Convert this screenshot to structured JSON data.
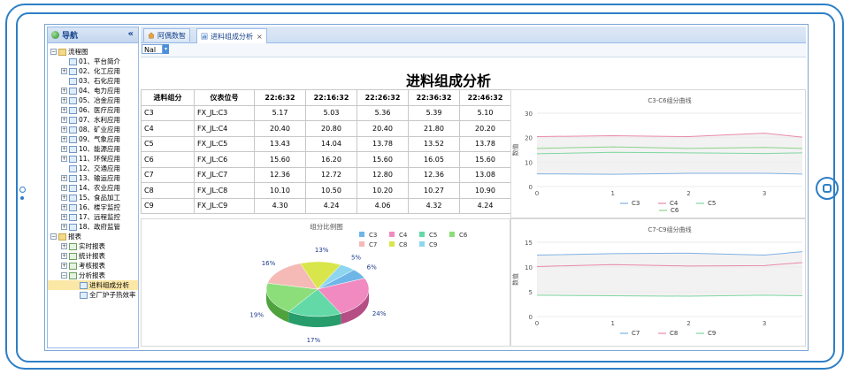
{
  "nav": {
    "title": "导航",
    "collapse_glyph": "«",
    "tree": [
      {
        "label": "流程图",
        "level": 0,
        "toggle": "⊟",
        "icon": "folder"
      },
      {
        "label": "01、平台简介",
        "level": 1,
        "toggle": "",
        "icon": "chart"
      },
      {
        "label": "02、化工应用",
        "level": 1,
        "toggle": "⊞",
        "icon": "chart"
      },
      {
        "label": "03、石化应用",
        "level": 1,
        "toggle": "",
        "icon": "chart"
      },
      {
        "label": "04、电力应用",
        "level": 1,
        "toggle": "⊞",
        "icon": "chart"
      },
      {
        "label": "05、冶金应用",
        "level": 1,
        "toggle": "⊞",
        "icon": "chart"
      },
      {
        "label": "06、医疗应用",
        "level": 1,
        "toggle": "⊞",
        "icon": "chart"
      },
      {
        "label": "07、水利应用",
        "level": 1,
        "toggle": "⊞",
        "icon": "chart"
      },
      {
        "label": "08、矿业应用",
        "level": 1,
        "toggle": "⊞",
        "icon": "chart"
      },
      {
        "label": "09、气象应用",
        "level": 1,
        "toggle": "⊞",
        "icon": "chart"
      },
      {
        "label": "10、能源应用",
        "level": 1,
        "toggle": "⊞",
        "icon": "chart"
      },
      {
        "label": "11、环保应用",
        "level": 1,
        "toggle": "⊞",
        "icon": "chart"
      },
      {
        "label": "12、交通应用",
        "level": 1,
        "toggle": "",
        "icon": "chart"
      },
      {
        "label": "13、输运应用",
        "level": 1,
        "toggle": "⊞",
        "icon": "chart"
      },
      {
        "label": "14、农业应用",
        "level": 1,
        "toggle": "⊞",
        "icon": "chart"
      },
      {
        "label": "15、食品加工",
        "level": 1,
        "toggle": "⊞",
        "icon": "chart"
      },
      {
        "label": "16、楼宇监控",
        "level": 1,
        "toggle": "⊞",
        "icon": "chart"
      },
      {
        "label": "17、远程监控",
        "level": 1,
        "toggle": "⊞",
        "icon": "chart"
      },
      {
        "label": "18、政府监管",
        "level": 1,
        "toggle": "⊞",
        "icon": "chart"
      },
      {
        "label": "报表",
        "level": 0,
        "toggle": "⊟",
        "icon": "folder"
      },
      {
        "label": "实时报表",
        "level": 1,
        "toggle": "⊞",
        "icon": "rpt"
      },
      {
        "label": "统计报表",
        "level": 1,
        "toggle": "⊞",
        "icon": "rpt"
      },
      {
        "label": "考核报表",
        "level": 1,
        "toggle": "⊞",
        "icon": "rpt"
      },
      {
        "label": "分析报表",
        "level": 1,
        "toggle": "⊟",
        "icon": "rpt"
      },
      {
        "label": "进料组成分析",
        "level": 2,
        "toggle": "",
        "icon": "chart",
        "selected": true
      },
      {
        "label": "全厂炉子热效率",
        "level": 2,
        "toggle": "",
        "icon": "chart"
      }
    ]
  },
  "tabs": [
    {
      "label": "阿偶数智",
      "icon": "home-icon",
      "closable": false,
      "active": false
    },
    {
      "label": "进料组成分析",
      "icon": "report-icon",
      "closable": true,
      "active": true
    }
  ],
  "toolbar": {
    "select_value": "Nal"
  },
  "report": {
    "title": "进料组成分析",
    "table": {
      "headers": [
        "进料组分",
        "仪表位号",
        "22:6:32",
        "22:16:32",
        "22:26:32",
        "22:36:32",
        "22:46:32"
      ],
      "rows": [
        [
          "C3",
          "FX_JL:C3",
          "5.17",
          "5.03",
          "5.36",
          "5.39",
          "5.10"
        ],
        [
          "C4",
          "FX_JL:C4",
          "20.40",
          "20.80",
          "20.40",
          "21.80",
          "20.20"
        ],
        [
          "C5",
          "FX_JL:C5",
          "13.43",
          "14.04",
          "13.78",
          "13.52",
          "13.78"
        ],
        [
          "C6",
          "FX_JL:C6",
          "15.60",
          "16.20",
          "15.60",
          "16.05",
          "15.60"
        ],
        [
          "C7",
          "FX_JL:C7",
          "12.36",
          "12.72",
          "12.80",
          "12.36",
          "13.08"
        ],
        [
          "C8",
          "FX_JL:C8",
          "10.10",
          "10.50",
          "10.20",
          "10.27",
          "10.90"
        ],
        [
          "C9",
          "FX_JL:C9",
          "4.30",
          "4.24",
          "4.06",
          "4.32",
          "4.24"
        ]
      ]
    }
  },
  "chart_data": [
    {
      "type": "line",
      "title": "C3-C6组分曲线",
      "ylabel": "数值",
      "xlabel": "",
      "x": [
        0,
        1,
        2,
        3,
        3.5
      ],
      "xticks": [
        0,
        1,
        2,
        3
      ],
      "ylim": [
        0,
        30
      ],
      "yticks": [
        0,
        10,
        20,
        30
      ],
      "series": [
        {
          "name": "C3",
          "color": "#7fb1e3",
          "values": [
            5.2,
            5.0,
            5.4,
            5.4,
            5.1
          ]
        },
        {
          "name": "C4",
          "color": "#e98aa8",
          "values": [
            20.4,
            20.8,
            20.4,
            21.8,
            20.2
          ]
        },
        {
          "name": "C5",
          "color": "#7fd7a1",
          "values": [
            13.4,
            14.0,
            13.8,
            13.5,
            13.8
          ]
        },
        {
          "name": "C6",
          "color": "#8ed18a",
          "values": [
            15.6,
            16.2,
            15.6,
            16.0,
            15.6
          ]
        }
      ],
      "legend_rows": [
        [
          "C3",
          "C4",
          "C5"
        ],
        [
          "C6"
        ]
      ],
      "legend": "bottom"
    },
    {
      "type": "pie",
      "title": "组分比例图",
      "labels": [
        "C3",
        "C4",
        "C5",
        "C6",
        "C7",
        "C8",
        "C9"
      ],
      "values": [
        6,
        24,
        17,
        19,
        16,
        13,
        5
      ],
      "value_labels": [
        "6%",
        "24%",
        "17%",
        "19%",
        "16%",
        "13%",
        "5%"
      ],
      "colors": [
        "#6fb6e8",
        "#f08ac0",
        "#62d9a7",
        "#8bde7a",
        "#f5b9b6",
        "#d9e64b",
        "#8ed6ef"
      ],
      "legend_rows": [
        [
          "C3",
          "C4",
          "C5",
          "C6"
        ],
        [
          "C7",
          "C8",
          "C9"
        ]
      ],
      "legend": "top-right"
    },
    {
      "type": "line",
      "title": "C7-C9组分曲线",
      "ylabel": "数值",
      "xlabel": "",
      "x": [
        0,
        1,
        2,
        3,
        3.5
      ],
      "xticks": [
        0,
        1,
        2,
        3
      ],
      "ylim": [
        0,
        15
      ],
      "yticks": [
        0,
        5,
        10,
        15
      ],
      "series": [
        {
          "name": "C7",
          "color": "#7fb1e3",
          "values": [
            12.4,
            12.7,
            12.8,
            12.4,
            13.1
          ]
        },
        {
          "name": "C8",
          "color": "#e98aa8",
          "values": [
            10.1,
            10.5,
            10.2,
            10.3,
            10.9
          ]
        },
        {
          "name": "C9",
          "color": "#7fd7a1",
          "values": [
            4.3,
            4.2,
            4.1,
            4.3,
            4.2
          ]
        }
      ],
      "legend_rows": [
        [
          "C7",
          "C8",
          "C9"
        ]
      ],
      "legend": "bottom"
    }
  ]
}
